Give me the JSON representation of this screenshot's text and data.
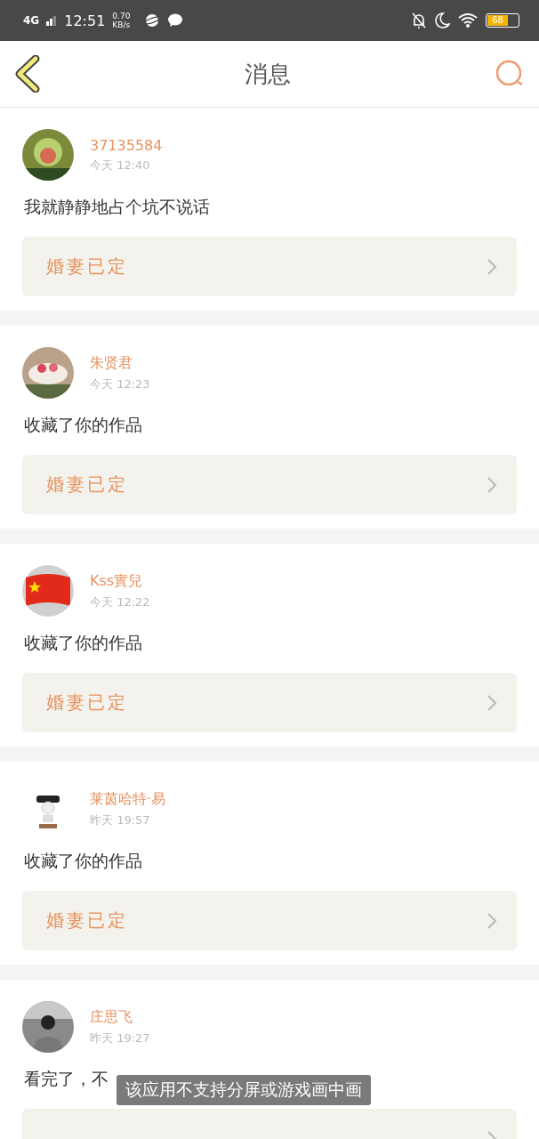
{
  "status_bar": {
    "network": "4G",
    "time": "12:51",
    "speed": "0.70",
    "speed_unit": "KB/s",
    "battery": "68"
  },
  "header": {
    "title": "消息"
  },
  "messages": [
    {
      "name": "37135584",
      "time": "今天 12:40",
      "text": "我就静静地占个坑不说话",
      "link": "婚妻已定"
    },
    {
      "name": "朱贤君",
      "time": "今天 12:23",
      "text": "收藏了你的作品",
      "link": "婚妻已定"
    },
    {
      "name": "Kss實兒",
      "time": "今天 12:22",
      "text": "收藏了你的作品",
      "link": "婚妻已定"
    },
    {
      "name": "莱茵哈特·易",
      "time": "昨天 19:57",
      "text": "收藏了你的作品",
      "link": "婚妻已定"
    },
    {
      "name": "庄思飞",
      "time": "昨天 19:27",
      "text": "看完了，不"
    }
  ],
  "toast": "该应用不支持分屏或游戏画中画"
}
